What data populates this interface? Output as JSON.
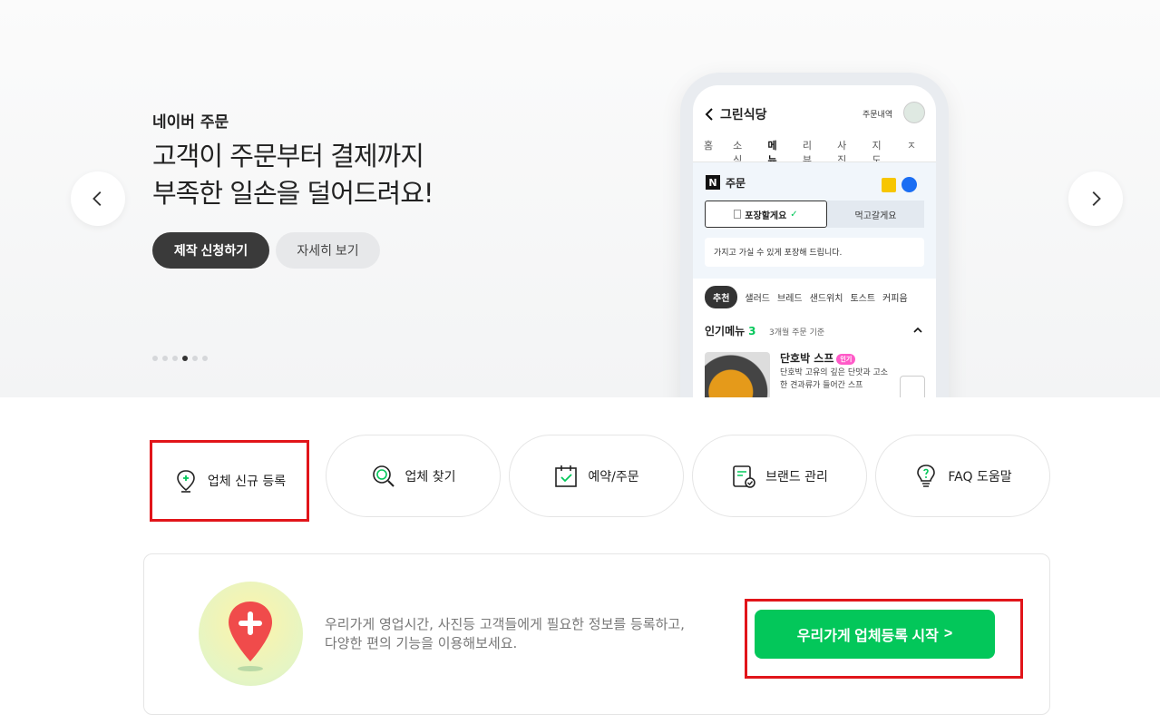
{
  "hero": {
    "subtitle": "네이버 주문",
    "title_line1": "고객이 주문부터 결제까지",
    "title_line2": "부족한 일손을 덜어드려요!",
    "primary_button": "제작 신청하기",
    "secondary_button": "자세히 보기",
    "slides": {
      "total": 6,
      "active": 4
    }
  },
  "phone": {
    "store_name": "그린식당",
    "order_history": "주문내역",
    "tabs": [
      "홈",
      "소식",
      "메뉴",
      "리뷰",
      "사진",
      "지도",
      "ㅈ"
    ],
    "active_tab": "메뉴",
    "order_badge": "N",
    "order_label": "주문",
    "option_takeout": "포장할게요",
    "option_dinein": "먹고갈게요",
    "note": "가지고 가실 수 있게 포장해 드립니다.",
    "chips": [
      "추천",
      "샐러드",
      "브레드",
      "샌드위치",
      "토스트",
      "커피음"
    ],
    "popular_title": "인기메뉴",
    "popular_count": "3",
    "popular_sub": "3개월 주문 기준",
    "food_name": "단호박 스프",
    "food_badge": "인기",
    "food_desc": "단호박 고유의 깊은 단맛과 고소한 견과류가 들어간 스프"
  },
  "quick_menu": {
    "items": [
      {
        "label": "업체 신규 등록",
        "icon": "map-pin-plus-icon"
      },
      {
        "label": "업체 찾기",
        "icon": "search-icon"
      },
      {
        "label": "예약/주문",
        "icon": "calendar-check-icon"
      },
      {
        "label": "브랜드 관리",
        "icon": "document-check-icon"
      },
      {
        "label": "FAQ 도움말",
        "icon": "lightbulb-question-icon"
      }
    ]
  },
  "register_card": {
    "text_line1": "우리가게 영업시간, 사진등 고객들에게 필요한 정보를 등록하고,",
    "text_line2": "다양한 편의 기능을 이용해보세요.",
    "button": "우리가게 업체등록 시작",
    "button_arrow": ">"
  },
  "colors": {
    "accent_green": "#03c75a",
    "highlight_red": "#e1151a",
    "dark_button": "#3a3a3a"
  }
}
